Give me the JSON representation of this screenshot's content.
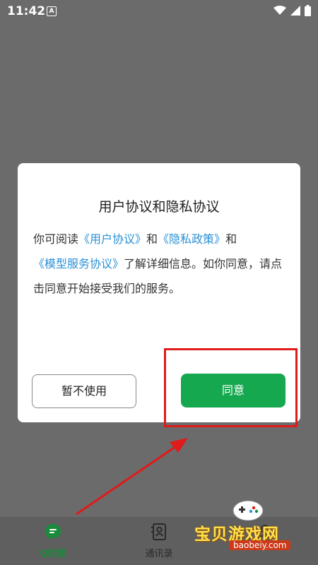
{
  "status_bar": {
    "time": "11:42",
    "a_indicator": "A"
  },
  "dialog": {
    "title": "用户协议和隐私协议",
    "body": {
      "t1": "你可阅读",
      "link_user_agreement": "《用户协议》",
      "t2": "和",
      "link_privacy_policy": "《隐私政策》",
      "t3": "和",
      "link_model_service": "《模型服务协议》",
      "t4": "了解详细信息。如你同意，请点击同意开始接受我们的服务。"
    },
    "decline_label": "暂不使用",
    "agree_label": "同意"
  },
  "bottom_nav": {
    "items": [
      {
        "label": "Q助理",
        "icon": "chat-icon",
        "active": true
      },
      {
        "label": "通讯录",
        "icon": "contacts-icon",
        "active": false
      },
      {
        "label": "",
        "icon": "person-icon",
        "active": false
      }
    ]
  },
  "watermark": {
    "title": "宝贝游戏网",
    "url": "baobeiy.com"
  },
  "colors": {
    "accent": "#16a84f",
    "link": "#2a91d6",
    "highlight": "#e11a1a"
  }
}
